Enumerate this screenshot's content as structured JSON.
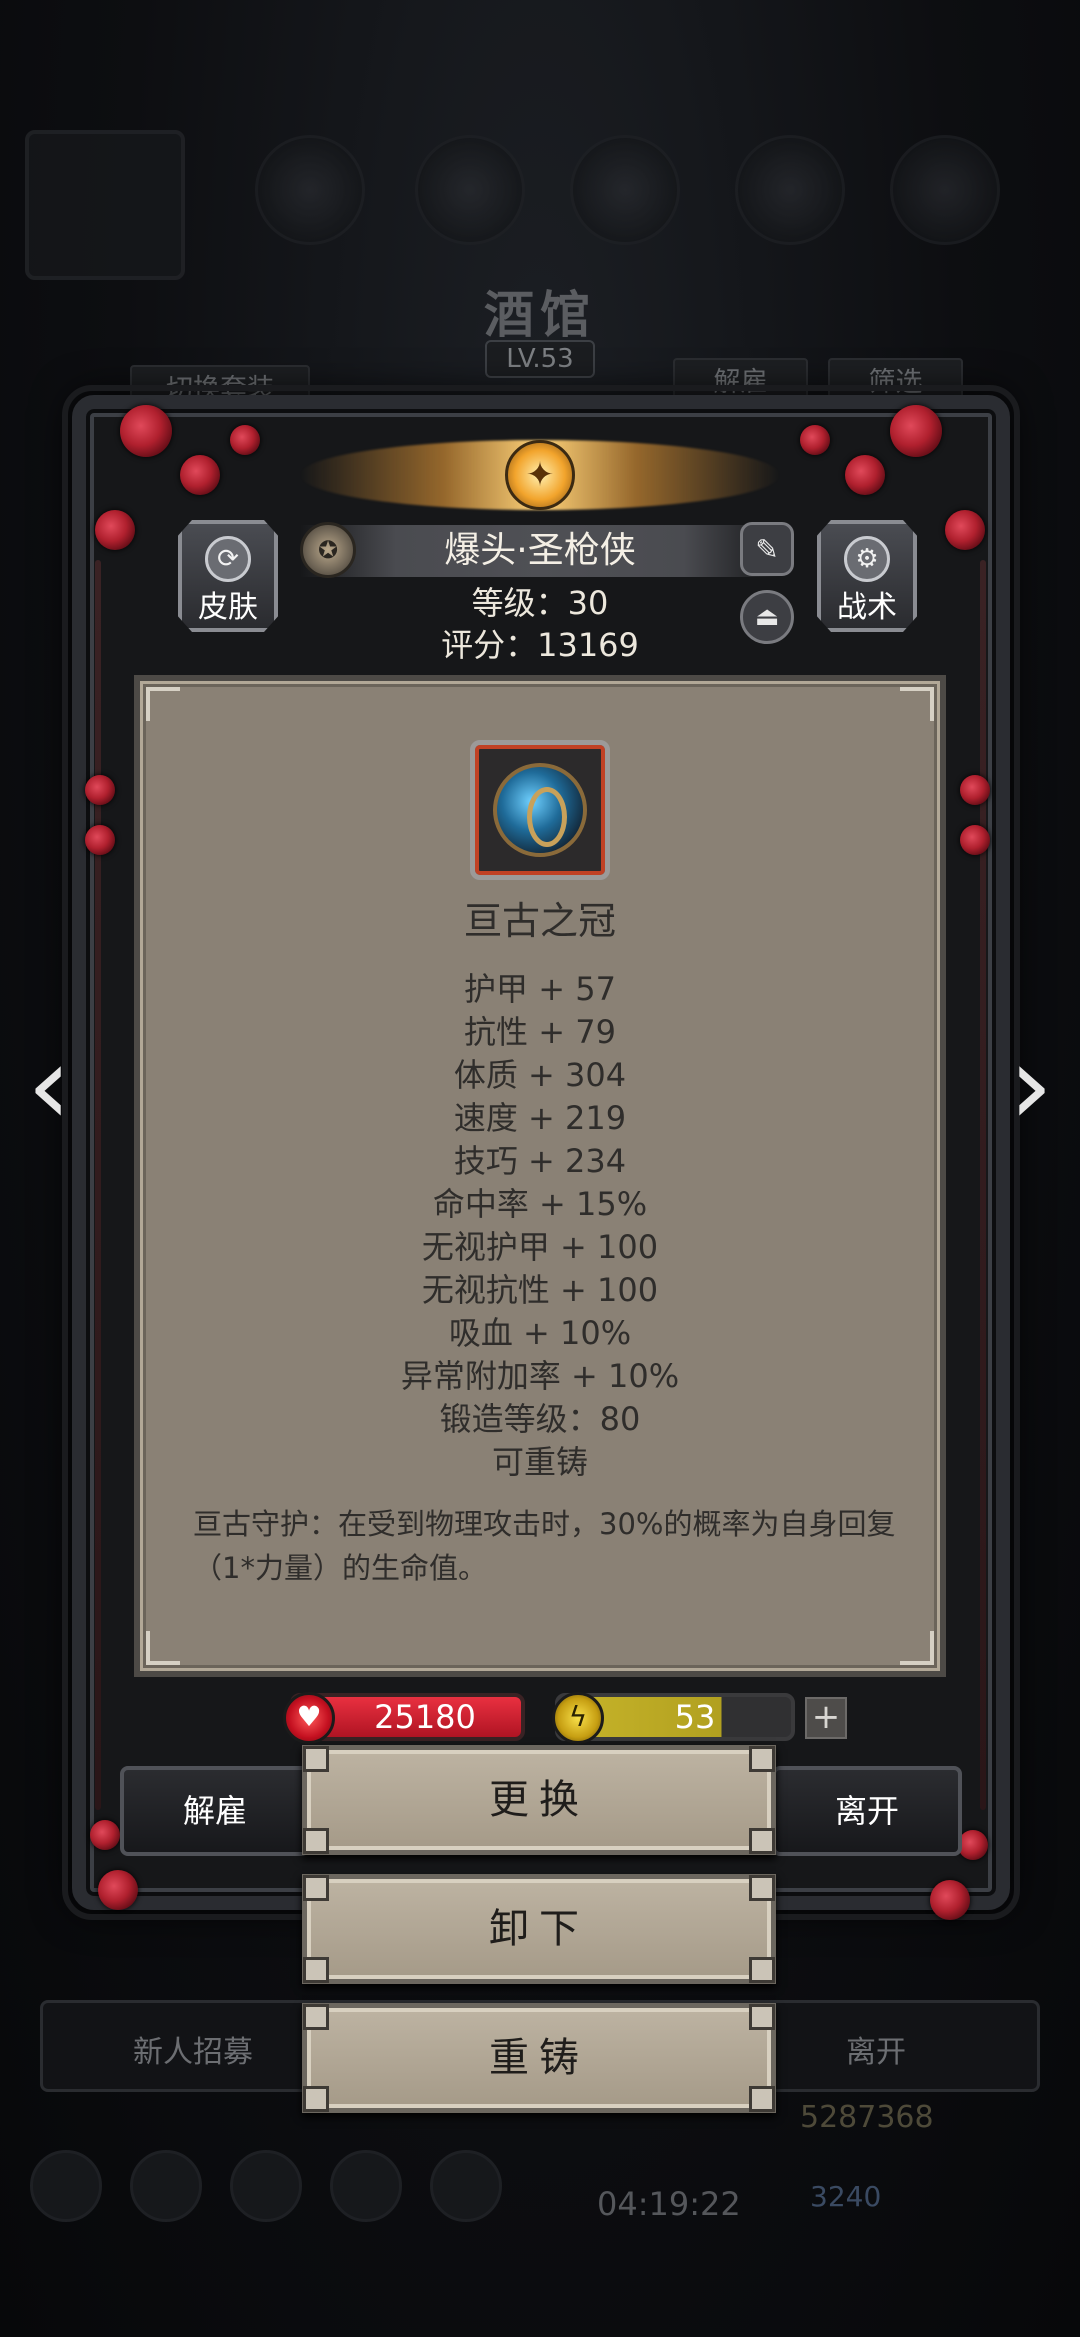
{
  "background": {
    "tavern_title": "酒馆",
    "tavern_level": "LV.53",
    "switch_outfit": "切换套装",
    "dismiss": "解雇",
    "filter": "筛选",
    "recruit": "新人招募",
    "leave": "离开",
    "gold": "5287368",
    "timer": "04:19:22",
    "gems": "3240"
  },
  "hero": {
    "name": "爆头·圣枪侠",
    "level_text": "等级：30",
    "score_text": "评分：13169",
    "skin_label": "皮肤",
    "tactics_label": "战术"
  },
  "item": {
    "name": "亘古之冠",
    "stats": [
      "护甲 + 57",
      "抗性 + 79",
      "体质 + 304",
      "速度 + 219",
      "技巧 + 234",
      "命中率 + 15%",
      "无视护甲 + 100",
      "无视抗性 + 100",
      "吸血 + 10%",
      "异常附加率 + 10%",
      "锻造等级：80",
      "可重铸"
    ],
    "description": "亘古守护：在受到物理攻击时，30%的概率为自身回复（1*力量）的生命值。"
  },
  "resources": {
    "hp": "25180",
    "energy": "53",
    "energy_fill_fraction": 0.7
  },
  "actions": {
    "dismiss": "解雇",
    "replace": "更换",
    "leave": "离开",
    "unequip": "卸下",
    "reforge": "重铸"
  },
  "colors": {
    "hp": "#d91f2f",
    "energy": "#c8b52a",
    "card": "#8a8175",
    "frame": "#2a2c31"
  }
}
